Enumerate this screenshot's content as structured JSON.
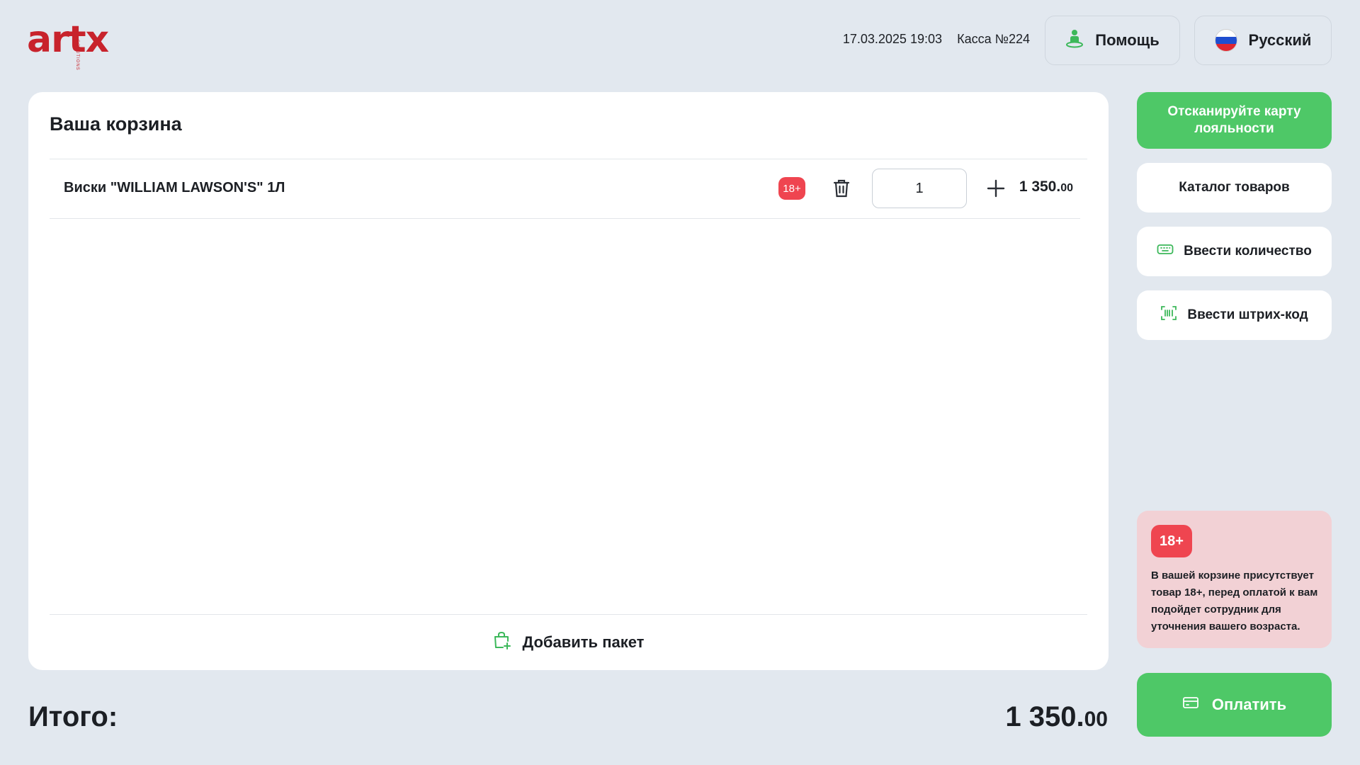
{
  "header": {
    "logo_text": "artx",
    "logo_sub": "SOLUTIONS",
    "datetime": "17.03.2025 19:03",
    "register": "Касса №224",
    "help_label": "Помощь",
    "language_label": "Русский"
  },
  "cart": {
    "title": "Ваша корзина",
    "items": [
      {
        "name": "Виски \"WILLIAM LAWSON'S\" 1Л",
        "age_badge": "18+",
        "quantity": "1",
        "price_main": "1 350.",
        "price_cents": "00"
      }
    ],
    "add_bag_label": "Добавить пакет"
  },
  "total": {
    "label": "Итого:",
    "amount_main": "1 350.",
    "amount_cents": "00"
  },
  "sidebar": {
    "loyalty_label": "Отсканируйте карту лояльности",
    "catalog_label": "Каталог товаров",
    "enter_qty_label": "Ввести количество",
    "enter_barcode_label": "Ввести штрих-код"
  },
  "warning": {
    "badge": "18+",
    "text": "В вашей корзине присутствует товар 18+, перед оплатой к вам подойдет сотрудник для уточнения вашего возраста."
  },
  "pay_label": "Оплатить",
  "colors": {
    "accent_green": "#4ec867",
    "badge_red": "#ef4550",
    "logo_red": "#c8232c",
    "background": "#e2e8ef",
    "warning_bg": "#f2d1d5"
  },
  "icons": {
    "help": "person-help-icon",
    "language": "russia-flag-icon",
    "delete": "trash-icon",
    "increment": "plus-icon",
    "bag": "shopping-bag-add-icon",
    "keyboard": "keyboard-icon",
    "barcode": "barcode-icon",
    "card": "credit-card-icon"
  }
}
